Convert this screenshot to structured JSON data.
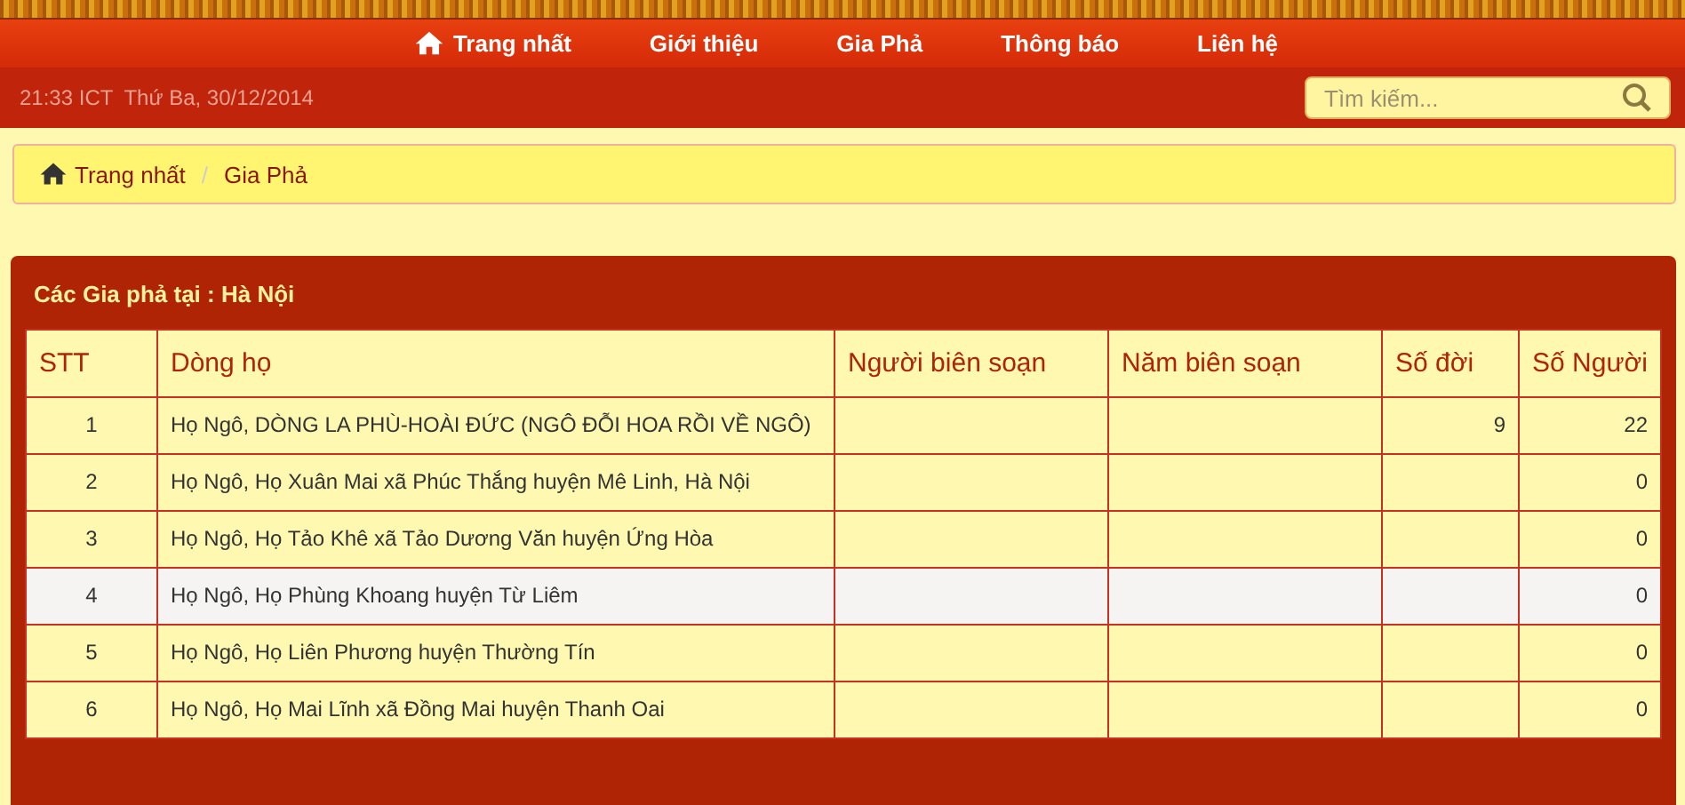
{
  "nav": [
    {
      "label": "Trang nhất",
      "kind": "home"
    },
    {
      "label": "Giới thiệu",
      "kind": "text"
    },
    {
      "label": "Gia Phả",
      "kind": "text"
    },
    {
      "label": "Thông báo",
      "kind": "text"
    },
    {
      "label": "Liên hệ",
      "kind": "text"
    }
  ],
  "info_bar": {
    "time": "21:33 ICT",
    "date": "Thứ Ba, 30/12/2014"
  },
  "search": {
    "placeholder": "Tìm kiếm..."
  },
  "breadcrumb": [
    {
      "label": "Trang nhất",
      "kind": "home"
    },
    {
      "label": "Gia Phả",
      "kind": "text"
    }
  ],
  "separator": "/",
  "panel": {
    "title": "Các Gia phả tại : Hà Nội"
  },
  "table": {
    "columns": [
      "STT",
      "Dòng họ",
      "Người biên soạn",
      "Năm biên soạn",
      "Số đời",
      "Số Người"
    ],
    "rows": [
      {
        "cells": [
          "1",
          "Họ Ngô, DÒNG LA PHÙ-HOÀI ĐỨC (NGÔ ĐỖI HOA RỒI VỀ NGÔ)",
          "",
          "",
          "9",
          "22"
        ],
        "highlighted": false
      },
      {
        "cells": [
          "2",
          "Họ Ngô, Họ Xuân Mai xã Phúc Thắng huyện Mê Linh, Hà Nội",
          "",
          "",
          "",
          "0"
        ],
        "highlighted": false
      },
      {
        "cells": [
          "3",
          "Họ Ngô, Họ Tảo Khê xã Tảo Dương Văn huyện Ứng Hòa",
          "",
          "",
          "",
          "0"
        ],
        "highlighted": false
      },
      {
        "cells": [
          "4",
          "Họ Ngô, Họ Phùng Khoang huyện Từ Liêm",
          "",
          "",
          "",
          "0"
        ],
        "highlighted": true
      },
      {
        "cells": [
          "5",
          "Họ Ngô, Họ Liên Phương huyện Thường Tín",
          "",
          "",
          "",
          "0"
        ],
        "highlighted": false
      },
      {
        "cells": [
          "6",
          "Họ Ngô, Họ Mai Lĩnh xã Đồng Mai huyện Thanh Oai",
          "",
          "",
          "",
          "0"
        ],
        "highlighted": false
      }
    ]
  }
}
